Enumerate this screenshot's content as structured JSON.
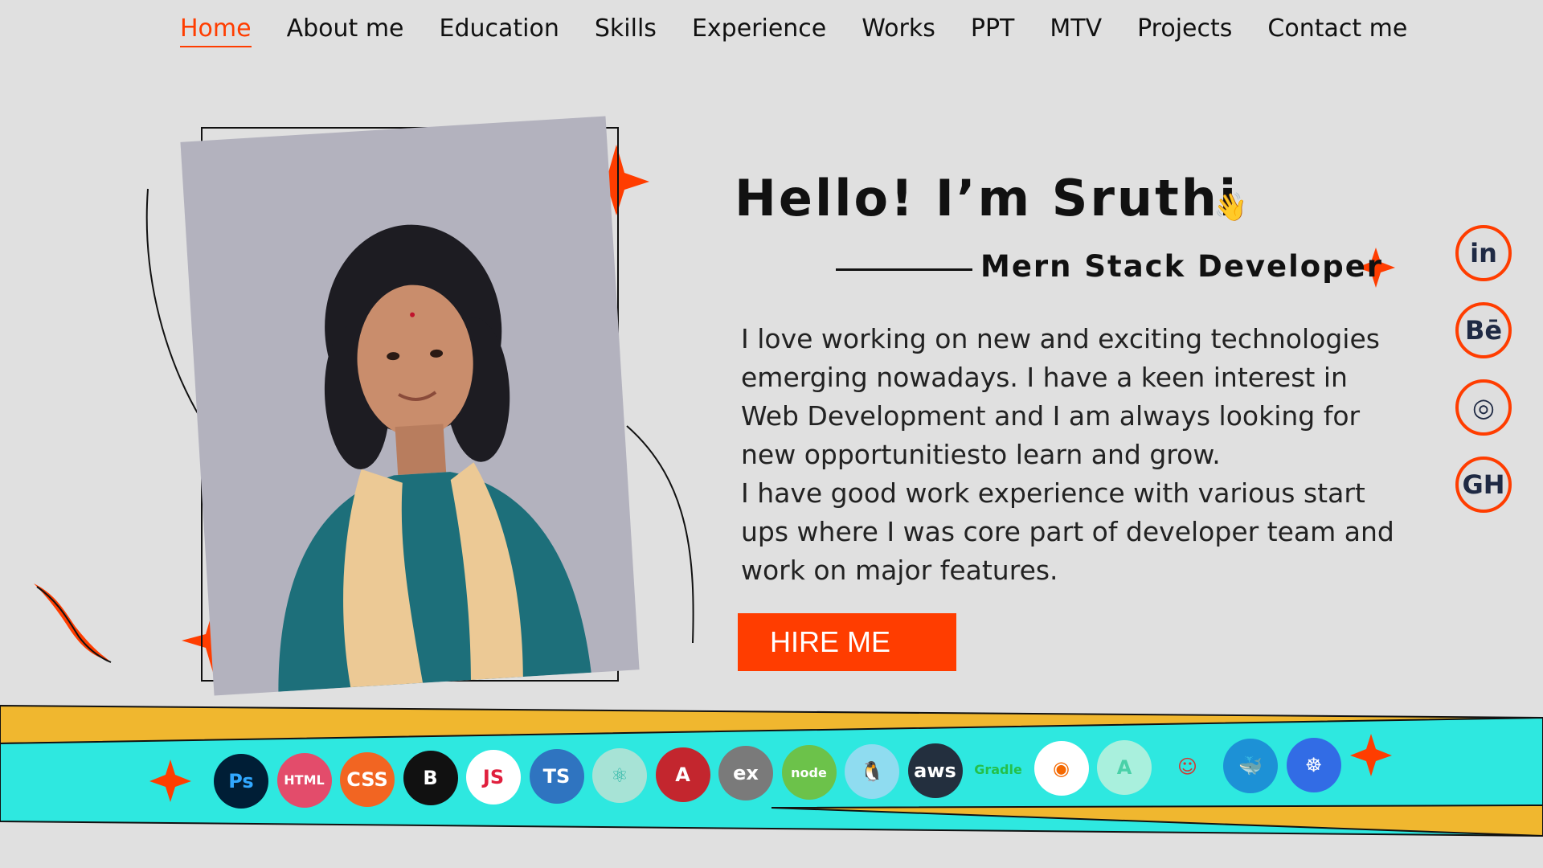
{
  "nav": {
    "items": [
      "Home",
      "About me",
      "Education",
      "Skills",
      "Experience",
      "Works",
      "PPT",
      "MTV",
      "Projects",
      "Contact me"
    ],
    "active": "Home"
  },
  "hero": {
    "greeting": "Hello! I’m Sruthi",
    "wave_icon": "waving-hand-icon",
    "role": "Mern Stack Developer",
    "about_lines": [
      "I love working on new and exciting technologies emerging nowadays. I have a keen interest in Web Development and I am always looking for new opportunitiesto learn and grow.",
      "I have good work experience with various start ups where I was core part of developer team and work on major features."
    ],
    "cta": "HIRE ME"
  },
  "social": [
    {
      "name": "linkedin-icon",
      "label": "in"
    },
    {
      "name": "behance-icon",
      "label": "Bē"
    },
    {
      "name": "dribbble-icon",
      "label": "◎"
    },
    {
      "name": "github-icon",
      "label": "GH"
    }
  ],
  "tech_icons": [
    {
      "name": "photoshop-icon",
      "label": "Ps",
      "bg": "#001e36",
      "fg": "#31a8ff"
    },
    {
      "name": "html-icon",
      "label": "HTML",
      "bg": "#e34c6b",
      "fg": "#ffffff"
    },
    {
      "name": "css-icon",
      "label": "CSS",
      "bg": "#f26522",
      "fg": "#ffffff"
    },
    {
      "name": "bootstrap-icon",
      "label": "B",
      "bg": "#111111",
      "fg": "#ffffff"
    },
    {
      "name": "javascript-icon",
      "label": "JS",
      "bg": "#ffffff",
      "fg": "#e01f3d"
    },
    {
      "name": "typescript-icon",
      "label": "TS",
      "bg": "#2f74c0",
      "fg": "#ffffff"
    },
    {
      "name": "react-icon",
      "label": "⚛",
      "bg": "#a7e3d6",
      "fg": "#2db7a7"
    },
    {
      "name": "angular-icon",
      "label": "A",
      "bg": "#c3262e",
      "fg": "#ffffff"
    },
    {
      "name": "express-icon",
      "label": "ex",
      "bg": "#7a7a7a",
      "fg": "#ffffff"
    },
    {
      "name": "nodejs-icon",
      "label": "node",
      "bg": "#6cc24a",
      "fg": "#ffffff"
    },
    {
      "name": "linux-icon",
      "label": "🐧",
      "bg": "#8fdcf0",
      "fg": "#111111"
    },
    {
      "name": "aws-icon",
      "label": "aws",
      "bg": "#232f3e",
      "fg": "#ffffff"
    },
    {
      "name": "gradle-icon",
      "label": "Gradle",
      "bg": "transparent",
      "fg": "#24c04a"
    },
    {
      "name": "grafana-icon",
      "label": "◉",
      "bg": "#ffffff",
      "fg": "#f46800"
    },
    {
      "name": "argo-icon",
      "label": "A",
      "bg": "#a9f0dd",
      "fg": "#49d1a8"
    },
    {
      "name": "jenkins-icon",
      "label": "☺",
      "bg": "transparent",
      "fg": "#d33833"
    },
    {
      "name": "docker-icon",
      "label": "🐳",
      "bg": "#1d91d6",
      "fg": "#ffffff"
    },
    {
      "name": "kubernetes-icon",
      "label": "☸",
      "bg": "#326ce5",
      "fg": "#ffffff"
    }
  ],
  "colors": {
    "accent": "#ff3d00",
    "band_cyan": "#2ee8e0",
    "band_yellow": "#f0b72f",
    "background": "#e0e0e0"
  }
}
